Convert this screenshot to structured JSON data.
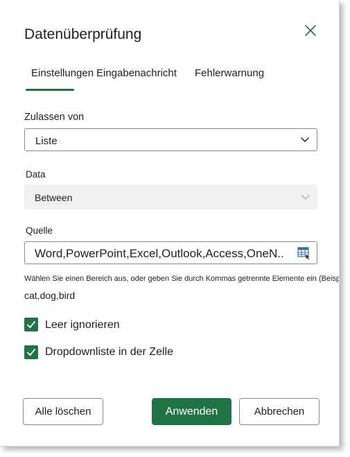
{
  "dialog": {
    "title": "Datenüberprüfung",
    "close_icon": "close-icon"
  },
  "tabs": [
    {
      "label": "Einstellungen",
      "selected": true
    },
    {
      "label": "Eingabenachricht",
      "selected": false
    },
    {
      "label": "Fehlerwarnung",
      "selected": false
    }
  ],
  "allow": {
    "label": "Zulassen von",
    "value": "Liste"
  },
  "data": {
    "label": "Data",
    "value": "Between",
    "disabled": true
  },
  "source": {
    "label": "Quelle",
    "value": "Word,PowerPoint,Excel,Outlook,Access,OneN...",
    "range_icon": "range-select-icon",
    "hint": "Wählen Sie einen Bereich aus, oder geben Sie durch Kommas getrennte Elemente ein (Beispiel:",
    "example": "cat,dog,bird"
  },
  "options": {
    "ignore_blank": {
      "label": "Leer ignorieren",
      "checked": true
    },
    "in_cell_dropdown": {
      "label": "Dropdownliste in der Zelle",
      "checked": true
    }
  },
  "buttons": {
    "clear_all": "Alle löschen",
    "apply": "Anwenden",
    "cancel": "Abbrechen"
  },
  "colors": {
    "accent": "#217346"
  }
}
